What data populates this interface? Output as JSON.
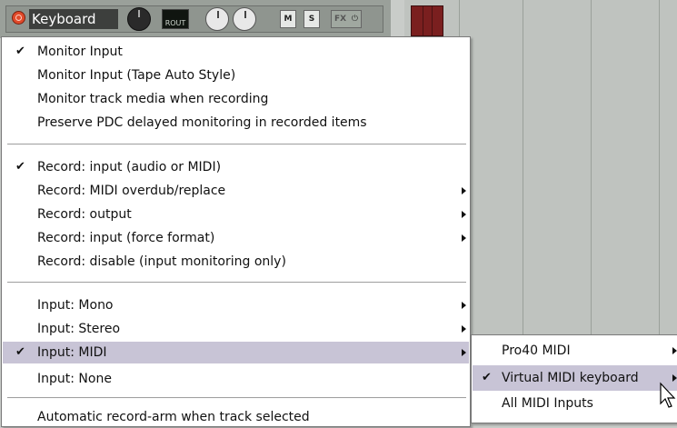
{
  "track": {
    "name": "Keyboard",
    "rout_label": "ROUT",
    "mute_label": "M",
    "solo_label": "S",
    "fx_label": "FX",
    "fx_power_icon": "power-icon"
  },
  "context_menu": {
    "items": [
      {
        "label": "Monitor Input",
        "checked": true,
        "submenu": false
      },
      {
        "label": "Monitor Input (Tape Auto Style)",
        "checked": false,
        "submenu": false
      },
      {
        "label": "Monitor track media when recording",
        "checked": false,
        "submenu": false
      },
      {
        "label": "Preserve PDC delayed monitoring in recorded items",
        "checked": false,
        "submenu": false
      },
      {
        "label": "Record: input (audio or MIDI)",
        "checked": true,
        "submenu": false
      },
      {
        "label": "Record: MIDI overdub/replace",
        "checked": false,
        "submenu": true
      },
      {
        "label": "Record: output",
        "checked": false,
        "submenu": true
      },
      {
        "label": "Record: input (force format)",
        "checked": false,
        "submenu": true
      },
      {
        "label": "Record: disable (input monitoring only)",
        "checked": false,
        "submenu": false
      },
      {
        "label": "Input: Mono",
        "checked": false,
        "submenu": true
      },
      {
        "label": "Input: Stereo",
        "checked": false,
        "submenu": true
      },
      {
        "label": "Input: MIDI",
        "checked": true,
        "submenu": true,
        "highlighted": true
      },
      {
        "label": "Input: None",
        "checked": false,
        "submenu": false
      },
      {
        "label": "Automatic record-arm when track selected",
        "checked": false,
        "submenu": false
      }
    ],
    "check_glyph": "✔"
  },
  "midi_submenu": {
    "items": [
      {
        "label": "Pro40 MIDI",
        "checked": false,
        "submenu": true
      },
      {
        "label": "Virtual MIDI keyboard",
        "checked": true,
        "submenu": true,
        "highlighted": true
      },
      {
        "label": "All MIDI Inputs",
        "checked": false,
        "submenu": false
      }
    ]
  },
  "colors": {
    "menu_highlight": "#c8c4d6",
    "record_button": "#e04a2a",
    "track_name_bg": "#3d3f3d"
  }
}
